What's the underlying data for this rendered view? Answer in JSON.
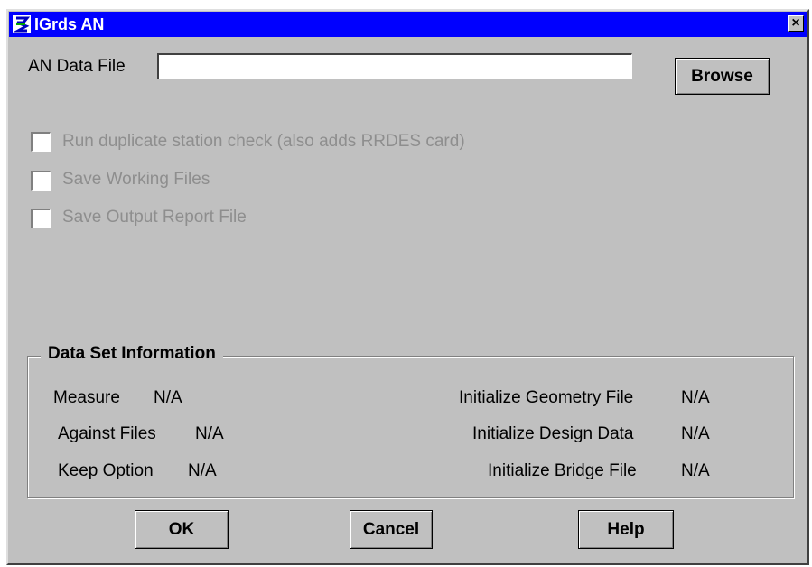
{
  "window": {
    "title": "IGrds AN",
    "close_label": "×"
  },
  "data_file": {
    "label": "AN Data File",
    "value": "",
    "placeholder": ""
  },
  "browse_label": "Browse",
  "checkboxes": [
    {
      "label": "Run duplicate station check (also adds RRDES card)",
      "checked": false,
      "enabled": false
    },
    {
      "label": "Save Working Files",
      "checked": false,
      "enabled": false
    },
    {
      "label": "Save Output Report File",
      "checked": false,
      "enabled": false
    }
  ],
  "data_set": {
    "title": "Data Set Information",
    "measure": {
      "label": "Measure",
      "value": "N/A"
    },
    "against_files": {
      "label": "Against Files",
      "value": "N/A"
    },
    "keep_option": {
      "label": "Keep Option",
      "value": "N/A"
    },
    "init_geometry": {
      "label": "Initialize Geometry File",
      "value": "N/A"
    },
    "init_design": {
      "label": "Initialize Design Data",
      "value": "N/A"
    },
    "init_bridge": {
      "label": "Initialize Bridge File",
      "value": "N/A"
    }
  },
  "buttons": {
    "ok": "OK",
    "cancel": "Cancel",
    "help": "Help"
  },
  "colors": {
    "titlebar": "#0000ff",
    "face": "#c0c0c0",
    "disabled_text": "#8e8e8e"
  },
  "icons": [
    "app-icon",
    "close-icon"
  ]
}
